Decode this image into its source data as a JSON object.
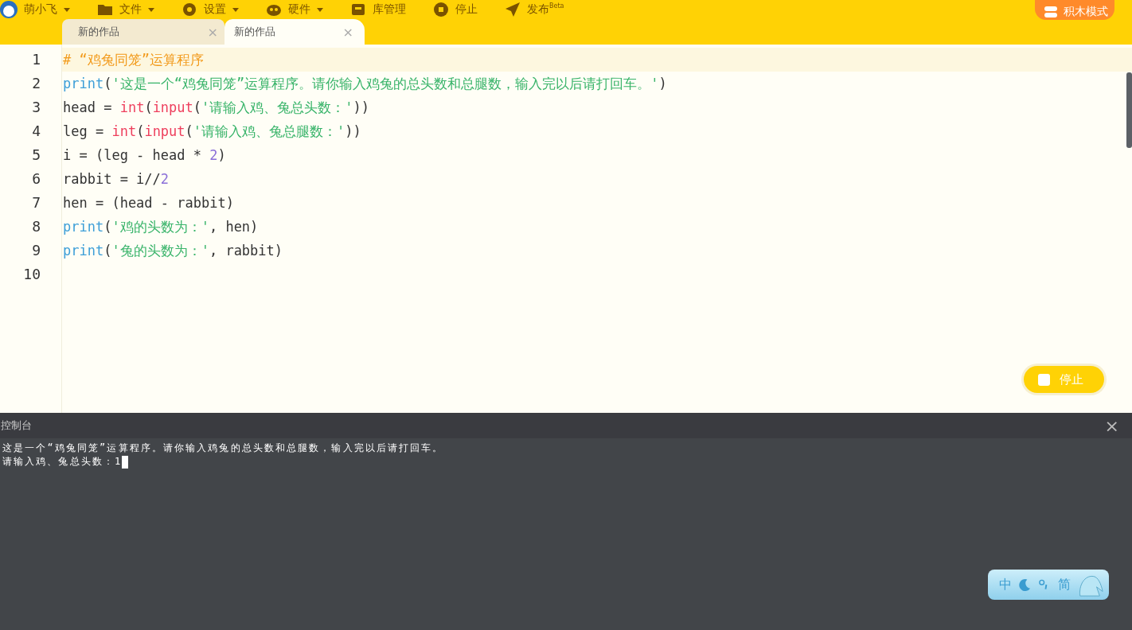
{
  "menu": [
    {
      "label": "萌小飞",
      "kind": "avatar",
      "caret": true
    },
    {
      "label": "文件",
      "kind": "folder",
      "caret": true
    },
    {
      "label": "设置",
      "kind": "gear",
      "caret": true
    },
    {
      "label": "硬件",
      "kind": "hardware",
      "caret": true
    },
    {
      "label": "库管理",
      "kind": "box",
      "caret": false
    },
    {
      "label": "停止",
      "kind": "stop",
      "caret": false
    },
    {
      "label": "发布$^{Beta}$",
      "kind": "plane",
      "caret": false
    }
  ],
  "mode_button": {
    "label": "积木模式"
  },
  "tabs": [
    {
      "label": "新的作品",
      "selected": false,
      "close": "×"
    },
    {
      "label": "新的作品",
      "selected": true,
      "close": "×"
    }
  ],
  "editor": {
    "lines": [
      {
        "number": "1",
        "highlighted": true,
        "tokens": [
          {
            "kind": "comment",
            "text": "# “鸡兔同笼”运算程序"
          }
        ]
      },
      {
        "number": "2",
        "tokens": [
          {
            "kind": "builtin",
            "text": "print"
          },
          {
            "kind": "plain",
            "text": "("
          },
          {
            "kind": "string",
            "text": "'这是一个“鸡兔同笼”运算程序。请你输入鸡兔的总头数和总腿数，输入完以后请打回车。'"
          },
          {
            "kind": "plain",
            "text": ")"
          }
        ]
      },
      {
        "number": "3",
        "tokens": [
          {
            "kind": "plain",
            "text": "head = "
          },
          {
            "kind": "func",
            "text": "int"
          },
          {
            "kind": "plain",
            "text": "("
          },
          {
            "kind": "func",
            "text": "input"
          },
          {
            "kind": "plain",
            "text": "("
          },
          {
            "kind": "string",
            "text": "'请输入鸡、兔总头数：'"
          },
          {
            "kind": "plain",
            "text": "))"
          }
        ]
      },
      {
        "number": "4",
        "tokens": [
          {
            "kind": "plain",
            "text": "leg = "
          },
          {
            "kind": "func",
            "text": "int"
          },
          {
            "kind": "plain",
            "text": "("
          },
          {
            "kind": "func",
            "text": "input"
          },
          {
            "kind": "plain",
            "text": "("
          },
          {
            "kind": "string",
            "text": "'请输入鸡、兔总腿数：'"
          },
          {
            "kind": "plain",
            "text": "))"
          }
        ]
      },
      {
        "number": "5",
        "tokens": [
          {
            "kind": "plain",
            "text": "i = (leg - head * "
          },
          {
            "kind": "number",
            "text": "2"
          },
          {
            "kind": "plain",
            "text": ")"
          }
        ]
      },
      {
        "number": "6",
        "tokens": [
          {
            "kind": "plain",
            "text": "rabbit = i//"
          },
          {
            "kind": "number",
            "text": "2"
          }
        ]
      },
      {
        "number": "7",
        "tokens": [
          {
            "kind": "plain",
            "text": "hen = (head - rabbit)"
          }
        ]
      },
      {
        "number": "8",
        "tokens": [
          {
            "kind": "builtin",
            "text": "print"
          },
          {
            "kind": "plain",
            "text": "("
          },
          {
            "kind": "string",
            "text": "'鸡的头数为：'"
          },
          {
            "kind": "plain",
            "text": ", hen)"
          }
        ]
      },
      {
        "number": "9",
        "tokens": [
          {
            "kind": "builtin",
            "text": "print"
          },
          {
            "kind": "plain",
            "text": "("
          },
          {
            "kind": "string",
            "text": "'兔的头数为：'"
          },
          {
            "kind": "plain",
            "text": ", rabbit)"
          }
        ]
      },
      {
        "number": "10"
      }
    ]
  },
  "stop_button": {
    "label": "停止"
  },
  "console": {
    "title": "控制台",
    "close": "×",
    "lines": [
      "这是一个“鸡兔同笼”运算程序。请你输入鸡兔的总头数和总腿数，输入完以后请打回车。"
    ],
    "prompt": "请输入鸡、兔总头数：",
    "input": "1"
  },
  "ime": {
    "labels": [
      "中",
      "简"
    ]
  }
}
